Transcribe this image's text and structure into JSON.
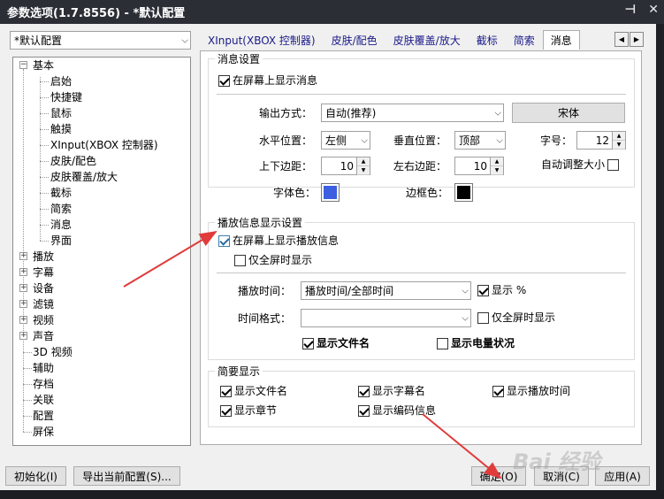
{
  "window": {
    "title": "参数选项(1.7.8556) - *默认配置",
    "pin_glyph": "⊣",
    "close_glyph": "✕"
  },
  "profile_combo": {
    "value": "*默认配置"
  },
  "tree": {
    "basic": "基本",
    "basic_children": [
      "启始",
      "快捷键",
      "鼠标",
      "触摸",
      "XInput(XBOX 控制器)",
      "皮肤/配色",
      "皮肤覆盖/放大",
      "截标",
      "简索",
      "消息",
      "界面"
    ],
    "others": [
      "播放",
      "字幕",
      "设备",
      "滤镜",
      "视频",
      "声音"
    ],
    "plain": [
      "3D 视频",
      "辅助",
      "存档",
      "关联",
      "配置",
      "屏保"
    ]
  },
  "tabs": [
    "XInput(XBOX 控制器)",
    "皮肤/配色",
    "皮肤覆盖/放大",
    "截标",
    "简索",
    "消息"
  ],
  "tab_scroll": {
    "left": "◀",
    "right": "▶"
  },
  "msg_group": {
    "title": "消息设置",
    "show_msg": "在屏幕上显示消息",
    "output_label": "输出方式：",
    "output_value": "自动(推荐)",
    "font_button": "宋体",
    "hpos_label": "水平位置：",
    "hpos_value": "左侧",
    "vpos_label": "垂直位置：",
    "vpos_value": "顶部",
    "size_label": "字号：",
    "size_value": "12",
    "tb_margin_label": "上下边距：",
    "tb_margin_value": "10",
    "lr_margin_label": "左右边距：",
    "lr_margin_value": "10",
    "autosize_label": "自动调整大小",
    "font_color_label": "字体色：",
    "border_color_label": "边框色：",
    "font_color": "#3b5fe0",
    "border_color": "#000000"
  },
  "play_group": {
    "title": "播放信息显示设置",
    "show_play": "在屏幕上显示播放信息",
    "full_only": "仅全屏时显示",
    "time_label": "播放时间：",
    "time_value": "播放时间/全部时间",
    "show_pct": "显示 %",
    "fmt_label": "时间格式：",
    "fmt_value": "",
    "fmt_full_only": "仅全屏时显示",
    "show_filename": "显示文件名",
    "show_battery": "显示电量状况"
  },
  "brief_group": {
    "title": "简要显示",
    "items": [
      "显示文件名",
      "显示字幕名",
      "显示播放时间",
      "显示章节",
      "显示编码信息"
    ]
  },
  "buttons": {
    "init": "初始化(I)",
    "export": "导出当前配置(S)...",
    "ok": "确定(O)",
    "cancel": "取消(C)",
    "apply": "应用(A)"
  },
  "watermark": "Bai 经验",
  "colors": {
    "titlebar": "#2b2e35",
    "client": "#f0f0f0",
    "arrow": "#e03c3c"
  }
}
